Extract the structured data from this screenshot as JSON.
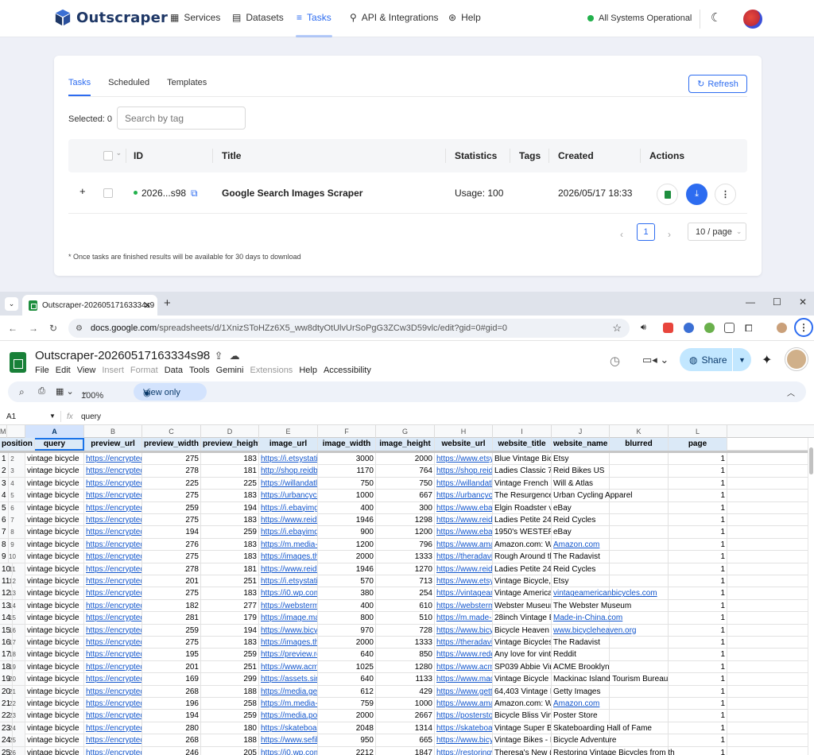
{
  "app": {
    "logo_text": "Outscraper",
    "nav": [
      "Services",
      "Datasets",
      "Tasks",
      "API & Integrations",
      "Help"
    ],
    "status": "All Systems Operational"
  },
  "card": {
    "tabs": [
      "Tasks",
      "Scheduled",
      "Templates"
    ],
    "refresh_label": "Refresh",
    "selected_label": "Selected: 0",
    "tag_placeholder": "Search by tag",
    "columns": [
      "ID",
      "Title",
      "Statistics",
      "Tags",
      "Created",
      "Actions"
    ],
    "row": {
      "expand": "+",
      "id": "2026...s98",
      "title": "Google Search Images Scraper",
      "statistics": "Usage: 100",
      "created": "2026/05/17 18:33"
    },
    "pager": {
      "page": "1",
      "page_size": "10 / page"
    },
    "note": "* Once tasks are finished results will be available for 30 days to download"
  },
  "browser": {
    "tab_title": "Outscraper-20260517163334s9",
    "url_domain": "docs.google.com",
    "url_rest": "/spreadsheets/d/1XnizSToHZz6X5_ww8dtyOtUlvUrSoPgG3ZCw3D59vlc/edit?gid=0#gid=0"
  },
  "sheets": {
    "doc_title": "Outscraper-20260517163334s98",
    "menu": [
      "File",
      "Edit",
      "View",
      "Insert",
      "Format",
      "Data",
      "Tools",
      "Gemini",
      "Extensions",
      "Help",
      "Accessibility"
    ],
    "share_label": "Share",
    "zoom": "100%",
    "view_only_label": "View only",
    "cell_ref": "A1",
    "formula_value": "query",
    "col_letters": [
      "A",
      "B",
      "C",
      "D",
      "E",
      "F",
      "G",
      "H",
      "I",
      "J",
      "K",
      "L",
      "M"
    ],
    "headers": [
      "query",
      "preview_url",
      "preview_width",
      "preview_height",
      "image_url",
      "image_width",
      "image_height",
      "website_url",
      "website_title",
      "website_name",
      "blurred",
      "page",
      "position"
    ],
    "rows": [
      [
        "2",
        "vintage bicycle",
        "https://encrypted",
        "275",
        "183",
        "https://i.etsystati",
        "3000",
        "2000",
        "https://www.etsy",
        "Blue Vintage Bic",
        "Etsy",
        "",
        "1",
        "1"
      ],
      [
        "3",
        "vintage bicycle",
        "https://encrypted",
        "278",
        "181",
        "http://shop.reidbi",
        "1170",
        "764",
        "https://shop.reidl",
        "Ladies Classic 7",
        "Reid Bikes US",
        "",
        "1",
        "2"
      ],
      [
        "4",
        "vintage bicycle",
        "https://encrypted",
        "225",
        "225",
        "https://willandatla",
        "750",
        "750",
        "https://willandatla",
        "Vintage French E",
        "Will & Atlas",
        "",
        "1",
        "3"
      ],
      [
        "5",
        "vintage bicycle",
        "https://encrypted",
        "275",
        "183",
        "https://urbancycl",
        "1000",
        "667",
        "https://urbancycl",
        "The Resurgence",
        "Urban Cycling Apparel",
        "",
        "1",
        "4"
      ],
      [
        "6",
        "vintage bicycle",
        "https://encrypted",
        "259",
        "194",
        "https://i.ebayimg",
        "400",
        "300",
        "https://www.ebay",
        "Elgin Roadster v",
        "eBay",
        "",
        "1",
        "5"
      ],
      [
        "7",
        "vintage bicycle",
        "https://encrypted",
        "275",
        "183",
        "https://www.reido",
        "1946",
        "1298",
        "https://www.reido",
        "Ladies Petite 24",
        "Reid Cycles",
        "",
        "1",
        "6"
      ],
      [
        "8",
        "vintage bicycle",
        "https://encrypted",
        "194",
        "259",
        "https://i.ebayimg",
        "900",
        "1200",
        "https://www.ebay",
        "1950's WESTER",
        "eBay",
        "",
        "1",
        "7"
      ],
      [
        "9",
        "vintage bicycle",
        "https://encrypted",
        "276",
        "183",
        "https://m.media-",
        "1200",
        "796",
        "https://www.ama",
        "Amazon.com: W",
        "Amazon.com",
        "",
        "1",
        "8"
      ],
      [
        "10",
        "vintage bicycle",
        "https://encrypted",
        "275",
        "183",
        "https://images.th",
        "2000",
        "1333",
        "https://theradavis",
        "Rough Around th",
        "The Radavist",
        "",
        "1",
        "9"
      ],
      [
        "11",
        "vintage bicycle",
        "https://encrypted",
        "278",
        "181",
        "https://www.reido",
        "1946",
        "1270",
        "https://www.reido",
        "Ladies Petite 24",
        "Reid Cycles",
        "",
        "1",
        "10"
      ],
      [
        "12",
        "vintage bicycle",
        "https://encrypted",
        "201",
        "251",
        "https://i.etsystati",
        "570",
        "713",
        "https://www.etsy",
        "Vintage Bicycle,",
        "Etsy",
        "",
        "1",
        "11"
      ],
      [
        "13",
        "vintage bicycle",
        "https://encrypted",
        "275",
        "183",
        "https://i0.wp.com",
        "380",
        "254",
        "https://vintagean",
        "Vintage America",
        "vintageamericanbicycles.com",
        "",
        "1",
        "12"
      ],
      [
        "14",
        "vintage bicycle",
        "https://encrypted",
        "182",
        "277",
        "https://websterm",
        "400",
        "610",
        "https://websterm",
        "Webster Museur",
        "The Webster Museum",
        "",
        "1",
        "13"
      ],
      [
        "15",
        "vintage bicycle",
        "https://encrypted",
        "281",
        "179",
        "https://image.ma",
        "800",
        "510",
        "https://m.made-i",
        "28inch Vintage E",
        "Made-in-China.com",
        "",
        "1",
        "14"
      ],
      [
        "16",
        "vintage bicycle",
        "https://encrypted",
        "259",
        "194",
        "https://www.bicy",
        "970",
        "728",
        "https://www.bicy",
        "Bicycle Heaven",
        "www.bicycleheaven.org",
        "",
        "1",
        "15"
      ],
      [
        "17",
        "vintage bicycle",
        "https://encrypted",
        "275",
        "183",
        "https://images.th",
        "2000",
        "1333",
        "https://theradavis",
        "Vintage Bicycles",
        "The Radavist",
        "",
        "1",
        "16"
      ],
      [
        "18",
        "vintage bicycle",
        "https://encrypted",
        "195",
        "259",
        "https://preview.re",
        "640",
        "850",
        "https://www.redd",
        "Any love for vint",
        "Reddit",
        "",
        "1",
        "17"
      ],
      [
        "19",
        "vintage bicycle",
        "https://encrypted",
        "201",
        "251",
        "https://www.acm",
        "1025",
        "1280",
        "https://www.acm",
        "SP039 Abbie Vir",
        "ACME Brooklyn",
        "",
        "1",
        "18"
      ],
      [
        "20",
        "vintage bicycle",
        "https://encrypted",
        "169",
        "299",
        "https://assets.sir",
        "640",
        "1133",
        "https://www.mac",
        "Vintage Bicycle I",
        "Mackinac Island Tourism Bureau",
        "",
        "1",
        "19"
      ],
      [
        "21",
        "vintage bicycle",
        "https://encrypted",
        "268",
        "188",
        "https://media.get",
        "612",
        "429",
        "https://www.getty",
        "64,403 Vintage E",
        "Getty Images",
        "",
        "1",
        "20"
      ],
      [
        "22",
        "vintage bicycle",
        "https://encrypted",
        "196",
        "258",
        "https://m.media-",
        "759",
        "1000",
        "https://www.ama",
        "Amazon.com: W",
        "Amazon.com",
        "",
        "1",
        "21"
      ],
      [
        "23",
        "vintage bicycle",
        "https://encrypted",
        "194",
        "259",
        "https://media.po",
        "2000",
        "2667",
        "https://postersto",
        "Bicycle Bliss Vin",
        "Poster Store",
        "",
        "1",
        "22"
      ],
      [
        "24",
        "vintage bicycle",
        "https://encrypted",
        "280",
        "180",
        "https://skateboa",
        "2048",
        "1314",
        "https://skateboa",
        "Vintage Super B",
        "Skateboarding Hall of Fame",
        "",
        "1",
        "23"
      ],
      [
        "25",
        "vintage bicycle",
        "https://encrypted",
        "268",
        "188",
        "https://www.sefil",
        "950",
        "665",
        "https://www.bicy",
        "Vintage Bikes - E",
        "Bicycle Adventure",
        "",
        "1",
        "24"
      ],
      [
        "26",
        "vintage bicycle",
        "https://encrypted",
        "246",
        "205",
        "https://i0.wp.com",
        "2212",
        "1847",
        "https://restoringv",
        "Theresa's New (",
        "Restoring Vintage Bicycles from th",
        "",
        "1",
        "25"
      ]
    ]
  }
}
